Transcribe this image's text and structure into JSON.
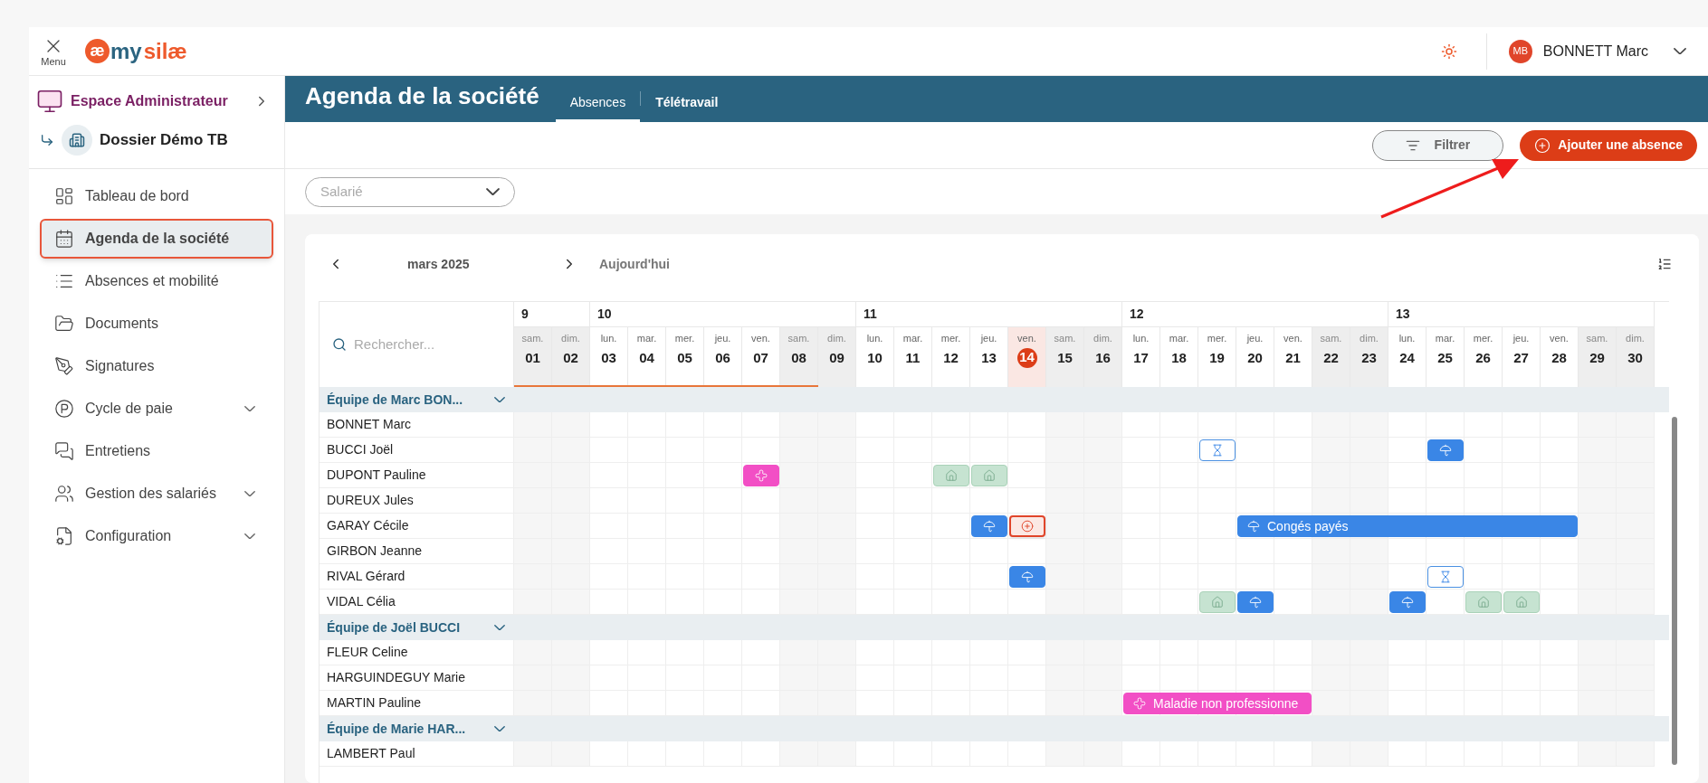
{
  "topbar": {
    "menu_label": "Menu",
    "logo": {
      "mark": "æ",
      "my": "my",
      "brand": "silæ"
    },
    "user": {
      "initials": "MB",
      "name": "BONNETT Marc"
    }
  },
  "sidebar": {
    "space": "Espace Administrateur",
    "dossier": "Dossier Démo TB",
    "items": [
      {
        "label": "Tableau de bord",
        "selected": false,
        "expandable": false
      },
      {
        "label": "Agenda de la société",
        "selected": true,
        "expandable": false
      },
      {
        "label": "Absences et mobilité",
        "selected": false,
        "expandable": false
      },
      {
        "label": "Documents",
        "selected": false,
        "expandable": false
      },
      {
        "label": "Signatures",
        "selected": false,
        "expandable": false
      },
      {
        "label": "Cycle de paie",
        "selected": false,
        "expandable": true
      },
      {
        "label": "Entretiens",
        "selected": false,
        "expandable": false
      },
      {
        "label": "Gestion des salariés",
        "selected": false,
        "expandable": true
      },
      {
        "label": "Configuration",
        "selected": false,
        "expandable": true
      }
    ]
  },
  "page": {
    "title": "Agenda de la société",
    "tabs": [
      {
        "label": "Absences",
        "selected": true
      },
      {
        "label": "Télétravail",
        "selected": false
      }
    ],
    "filter_button": "Filtrer",
    "add_button": "Ajouter une absence",
    "employee_select": {
      "placeholder": "Salarié"
    }
  },
  "calendar": {
    "month": "mars 2025",
    "today_button": "Aujourd'hui",
    "search": {
      "placeholder": "Rechercher..."
    },
    "weeks": [
      {
        "label": "9",
        "days": [
          {
            "weekday": "sam.",
            "date": "01",
            "weekend": true,
            "today": false,
            "period": true
          },
          {
            "weekday": "dim.",
            "date": "02",
            "weekend": true,
            "today": false,
            "period": true
          }
        ]
      },
      {
        "label": "10",
        "days": [
          {
            "weekday": "lun.",
            "date": "03",
            "weekend": false,
            "today": false,
            "period": true
          },
          {
            "weekday": "mar.",
            "date": "04",
            "weekend": false,
            "today": false,
            "period": true
          },
          {
            "weekday": "mer.",
            "date": "05",
            "weekend": false,
            "today": false,
            "period": true
          },
          {
            "weekday": "jeu.",
            "date": "06",
            "weekend": false,
            "today": false,
            "period": true
          },
          {
            "weekday": "ven.",
            "date": "07",
            "weekend": false,
            "today": false,
            "period": true
          },
          {
            "weekday": "sam.",
            "date": "08",
            "weekend": true,
            "today": false,
            "period": true
          },
          {
            "weekday": "dim.",
            "date": "09",
            "weekend": true,
            "today": false,
            "period": false
          }
        ]
      },
      {
        "label": "11",
        "days": [
          {
            "weekday": "lun.",
            "date": "10",
            "weekend": false,
            "today": false,
            "period": false
          },
          {
            "weekday": "mar.",
            "date": "11",
            "weekend": false,
            "today": false,
            "period": false
          },
          {
            "weekday": "mer.",
            "date": "12",
            "weekend": false,
            "today": false,
            "period": false
          },
          {
            "weekday": "jeu.",
            "date": "13",
            "weekend": false,
            "today": false,
            "period": false
          },
          {
            "weekday": "ven.",
            "date": "14",
            "weekend": false,
            "today": true,
            "period": false
          },
          {
            "weekday": "sam.",
            "date": "15",
            "weekend": true,
            "today": false,
            "period": false
          },
          {
            "weekday": "dim.",
            "date": "16",
            "weekend": true,
            "today": false,
            "period": false
          }
        ]
      },
      {
        "label": "12",
        "days": [
          {
            "weekday": "lun.",
            "date": "17",
            "weekend": false,
            "today": false,
            "period": false
          },
          {
            "weekday": "mar.",
            "date": "18",
            "weekend": false,
            "today": false,
            "period": false
          },
          {
            "weekday": "mer.",
            "date": "19",
            "weekend": false,
            "today": false,
            "period": false
          },
          {
            "weekday": "jeu.",
            "date": "20",
            "weekend": false,
            "today": false,
            "period": false
          },
          {
            "weekday": "ven.",
            "date": "21",
            "weekend": false,
            "today": false,
            "period": false
          },
          {
            "weekday": "sam.",
            "date": "22",
            "weekend": true,
            "today": false,
            "period": false
          },
          {
            "weekday": "dim.",
            "date": "23",
            "weekend": true,
            "today": false,
            "period": false
          }
        ]
      },
      {
        "label": "13",
        "days": [
          {
            "weekday": "lun.",
            "date": "24",
            "weekend": false,
            "today": false,
            "period": false
          },
          {
            "weekday": "mar.",
            "date": "25",
            "weekend": false,
            "today": false,
            "period": false
          },
          {
            "weekday": "mer.",
            "date": "26",
            "weekend": false,
            "today": false,
            "period": false
          },
          {
            "weekday": "jeu.",
            "date": "27",
            "weekend": false,
            "today": false,
            "period": false
          },
          {
            "weekday": "ven.",
            "date": "28",
            "weekend": false,
            "today": false,
            "period": false
          },
          {
            "weekday": "sam.",
            "date": "29",
            "weekend": true,
            "today": false,
            "period": false
          },
          {
            "weekday": "dim.",
            "date": "30",
            "weekend": true,
            "today": false,
            "period": false
          }
        ]
      }
    ],
    "groups": [
      {
        "name": "Équipe de Marc BON...",
        "expanded": true,
        "employees": [
          {
            "name": "BONNET Marc"
          },
          {
            "name": "BUCCI Joël",
            "cells": [
              {
                "kind": "free"
              },
              {
                "kind": "free"
              },
              {
                "kind": "free"
              },
              {
                "kind": "free"
              },
              {
                "kind": "free"
              },
              {
                "kind": "free"
              },
              {
                "kind": "free"
              },
              {
                "kind": "free"
              },
              {
                "kind": "free"
              },
              {
                "kind": "free"
              },
              {
                "kind": "free"
              },
              {
                "kind": "free"
              },
              {
                "kind": "free"
              },
              {
                "kind": "free"
              },
              {
                "kind": "free"
              },
              {
                "kind": "free"
              },
              {
                "kind": "free"
              },
              {
                "kind": "free"
              },
              {
                "kind": "pending"
              },
              {
                "kind": "free"
              },
              {
                "kind": "free"
              },
              {
                "kind": "free"
              },
              {
                "kind": "free"
              },
              {
                "kind": "free"
              },
              {
                "kind": "leave"
              },
              {
                "kind": "free"
              },
              {
                "kind": "free"
              },
              {
                "kind": "free"
              },
              {
                "kind": "free"
              },
              {
                "kind": "free"
              }
            ]
          },
          {
            "name": "DUPONT Pauline",
            "cells": [
              {
                "kind": "free"
              },
              {
                "kind": "free"
              },
              {
                "kind": "free"
              },
              {
                "kind": "free"
              },
              {
                "kind": "free"
              },
              {
                "kind": "free"
              },
              {
                "kind": "sick"
              },
              {
                "kind": "free"
              },
              {
                "kind": "free"
              },
              {
                "kind": "free"
              },
              {
                "kind": "free"
              },
              {
                "kind": "telework"
              },
              {
                "kind": "telework"
              },
              {
                "kind": "free"
              },
              {
                "kind": "free"
              },
              {
                "kind": "free"
              },
              {
                "kind": "free"
              },
              {
                "kind": "free"
              },
              {
                "kind": "free"
              },
              {
                "kind": "free"
              },
              {
                "kind": "free"
              },
              {
                "kind": "free"
              },
              {
                "kind": "free"
              },
              {
                "kind": "free"
              },
              {
                "kind": "free"
              },
              {
                "kind": "free"
              },
              {
                "kind": "free"
              },
              {
                "kind": "free"
              },
              {
                "kind": "free"
              },
              {
                "kind": "free"
              }
            ]
          },
          {
            "name": "DUREUX Jules"
          },
          {
            "name": "GARAY Cécile",
            "cells": [
              {
                "kind": "free"
              },
              {
                "kind": "free"
              },
              {
                "kind": "free"
              },
              {
                "kind": "free"
              },
              {
                "kind": "free"
              },
              {
                "kind": "free"
              },
              {
                "kind": "free"
              },
              {
                "kind": "free"
              },
              {
                "kind": "free"
              },
              {
                "kind": "free"
              },
              {
                "kind": "free"
              },
              {
                "kind": "free"
              },
              {
                "kind": "leave"
              },
              {
                "kind": "add"
              },
              {
                "kind": "free"
              },
              {
                "kind": "free"
              },
              {
                "kind": "free"
              },
              {
                "kind": "free"
              },
              {
                "kind": "free"
              },
              {
                "kind": "leave",
                "label": "Congés payés"
              },
              {
                "kind": "leave",
                "continued": true
              },
              {
                "kind": "leave",
                "continued": true
              },
              {
                "kind": "leave",
                "continued": true
              },
              {
                "kind": "leave",
                "continued": true
              },
              {
                "kind": "leave",
                "continued": true
              },
              {
                "kind": "leave",
                "continued": true
              },
              {
                "kind": "leave",
                "continued": true
              },
              {
                "kind": "leave",
                "continued": true
              },
              {
                "kind": "free"
              },
              {
                "kind": "free"
              }
            ]
          },
          {
            "name": "GIRBON Jeanne"
          },
          {
            "name": "RIVAL Gérard",
            "cells": [
              {
                "kind": "free"
              },
              {
                "kind": "free"
              },
              {
                "kind": "free"
              },
              {
                "kind": "free"
              },
              {
                "kind": "free"
              },
              {
                "kind": "free"
              },
              {
                "kind": "free"
              },
              {
                "kind": "free"
              },
              {
                "kind": "free"
              },
              {
                "kind": "free"
              },
              {
                "kind": "free"
              },
              {
                "kind": "free"
              },
              {
                "kind": "free"
              },
              {
                "kind": "leave"
              },
              {
                "kind": "free"
              },
              {
                "kind": "free"
              },
              {
                "kind": "free"
              },
              {
                "kind": "free"
              },
              {
                "kind": "free"
              },
              {
                "kind": "free"
              },
              {
                "kind": "free"
              },
              {
                "kind": "free"
              },
              {
                "kind": "free"
              },
              {
                "kind": "free"
              },
              {
                "kind": "pending"
              },
              {
                "kind": "free"
              },
              {
                "kind": "free"
              },
              {
                "kind": "free"
              },
              {
                "kind": "free"
              },
              {
                "kind": "free"
              }
            ]
          },
          {
            "name": "VIDAL Célia",
            "cells": [
              {
                "kind": "free"
              },
              {
                "kind": "free"
              },
              {
                "kind": "free"
              },
              {
                "kind": "free"
              },
              {
                "kind": "free"
              },
              {
                "kind": "free"
              },
              {
                "kind": "free"
              },
              {
                "kind": "free"
              },
              {
                "kind": "free"
              },
              {
                "kind": "free"
              },
              {
                "kind": "free"
              },
              {
                "kind": "free"
              },
              {
                "kind": "free"
              },
              {
                "kind": "free"
              },
              {
                "kind": "free"
              },
              {
                "kind": "free"
              },
              {
                "kind": "free"
              },
              {
                "kind": "free"
              },
              {
                "kind": "telework"
              },
              {
                "kind": "leave"
              },
              {
                "kind": "free"
              },
              {
                "kind": "free"
              },
              {
                "kind": "free"
              },
              {
                "kind": "leave"
              },
              {
                "kind": "free"
              },
              {
                "kind": "telework"
              },
              {
                "kind": "telework"
              },
              {
                "kind": "free"
              },
              {
                "kind": "free"
              },
              {
                "kind": "free"
              }
            ]
          }
        ]
      },
      {
        "name": "Équipe de Joël BUCCI",
        "expanded": true,
        "employees": [
          {
            "name": "FLEUR Celine"
          },
          {
            "name": "HARGUINDEGUY Marie"
          },
          {
            "name": "MARTIN Pauline",
            "cells": [
              {
                "kind": "free"
              },
              {
                "kind": "free"
              },
              {
                "kind": "free"
              },
              {
                "kind": "free"
              },
              {
                "kind": "free"
              },
              {
                "kind": "free"
              },
              {
                "kind": "free"
              },
              {
                "kind": "free"
              },
              {
                "kind": "free"
              },
              {
                "kind": "free"
              },
              {
                "kind": "free"
              },
              {
                "kind": "free"
              },
              {
                "kind": "free"
              },
              {
                "kind": "free"
              },
              {
                "kind": "free"
              },
              {
                "kind": "free"
              },
              {
                "kind": "sick",
                "label": "Maladie non professionne"
              },
              {
                "kind": "sick",
                "continued": true
              },
              {
                "kind": "sick",
                "continued": true
              },
              {
                "kind": "sick",
                "continued": true
              },
              {
                "kind": "sick",
                "continued": true
              },
              {
                "kind": "free"
              },
              {
                "kind": "free"
              },
              {
                "kind": "free"
              },
              {
                "kind": "free"
              },
              {
                "kind": "free"
              },
              {
                "kind": "free"
              },
              {
                "kind": "free"
              },
              {
                "kind": "free"
              },
              {
                "kind": "free"
              }
            ]
          }
        ]
      },
      {
        "name": "Équipe de Marie HAR...",
        "expanded": true,
        "employees": [
          {
            "name": "LAMBERT Paul"
          }
        ]
      }
    ]
  }
}
